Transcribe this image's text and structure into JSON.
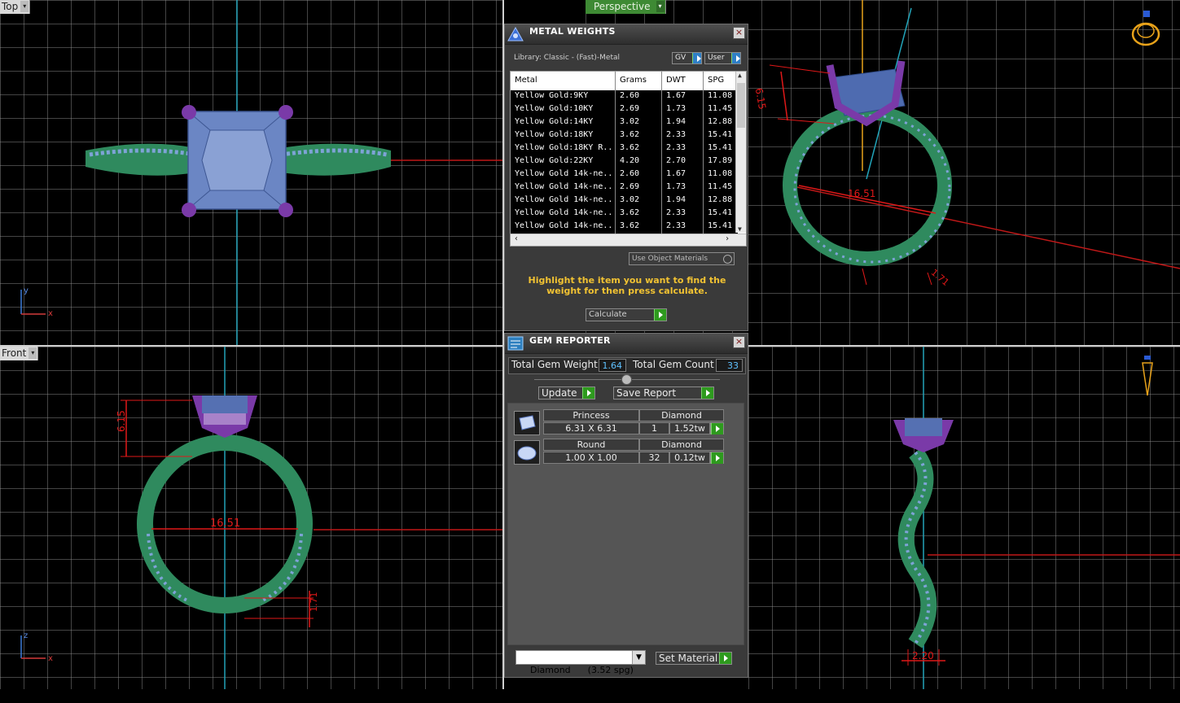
{
  "viewports": {
    "top": {
      "label": "Top",
      "axis_v": "y",
      "axis_h": "x"
    },
    "perspective": {
      "label": "Perspective",
      "dim_height": "6.15",
      "dim_diameter": "16.51",
      "dim_band": "1.71"
    },
    "front": {
      "label": "Front",
      "axis_v": "z",
      "axis_h": "x",
      "dim_height": "6.15",
      "dim_diameter": "16.51",
      "dim_band": "1.71"
    },
    "right": {
      "dim_width": "2.20"
    }
  },
  "metal_weights": {
    "title": "METAL WEIGHTS",
    "library": "Library: Classic - (Fast)-Metal",
    "gv_label": "GV",
    "user_label": "User",
    "columns": [
      "Metal",
      "Grams",
      "DWT",
      "SPG"
    ],
    "rows": [
      [
        "Yellow Gold:9KY",
        "2.60",
        "1.67",
        "11.08"
      ],
      [
        "Yellow Gold:10KY",
        "2.69",
        "1.73",
        "11.45"
      ],
      [
        "Yellow Gold:14KY",
        "3.02",
        "1.94",
        "12.88"
      ],
      [
        "Yellow Gold:18KY",
        "3.62",
        "2.33",
        "15.41"
      ],
      [
        "Yellow Gold:18KY R...",
        "3.62",
        "2.33",
        "15.41"
      ],
      [
        "Yellow Gold:22KY",
        "4.20",
        "2.70",
        "17.89"
      ],
      [
        "Yellow Gold 14k-ne...",
        "2.60",
        "1.67",
        "11.08"
      ],
      [
        "Yellow Gold 14k-ne...",
        "2.69",
        "1.73",
        "11.45"
      ],
      [
        "Yellow Gold 14k-ne...",
        "3.02",
        "1.94",
        "12.88"
      ],
      [
        "Yellow Gold 14k-ne...",
        "3.62",
        "2.33",
        "15.41"
      ],
      [
        "Yellow Gold 14k-ne...",
        "3.62",
        "2.33",
        "15.41"
      ]
    ],
    "use_object_materials": "Use Object Materials",
    "hint": "Highlight the item you want to find the weight for then press calculate.",
    "calculate_label": "Calculate"
  },
  "gem_reporter": {
    "title": "GEM REPORTER",
    "total_weight_label": "Total Gem Weight",
    "total_weight": "1.64",
    "total_count_label": "Total Gem Count",
    "total_count": "33",
    "update_label": "Update",
    "save_report_label": "Save Report",
    "gems": [
      {
        "shape": "Princess",
        "material": "Diamond",
        "size": "6.31 X 6.31",
        "count": "1",
        "weight": "1.52tw"
      },
      {
        "shape": "Round",
        "material": "Diamond",
        "size": "1.00 X 1.00",
        "count": "32",
        "weight": "0.12tw"
      }
    ],
    "material_select": "Diamond      (3.52 spg)",
    "set_material_label": "Set Material"
  },
  "colors": {
    "metal": "#2f8a5e",
    "prongs": "#7a3aa8",
    "gem": "#5f7fc0",
    "dimension": "#e01818",
    "accent_text": "#f1c232"
  }
}
